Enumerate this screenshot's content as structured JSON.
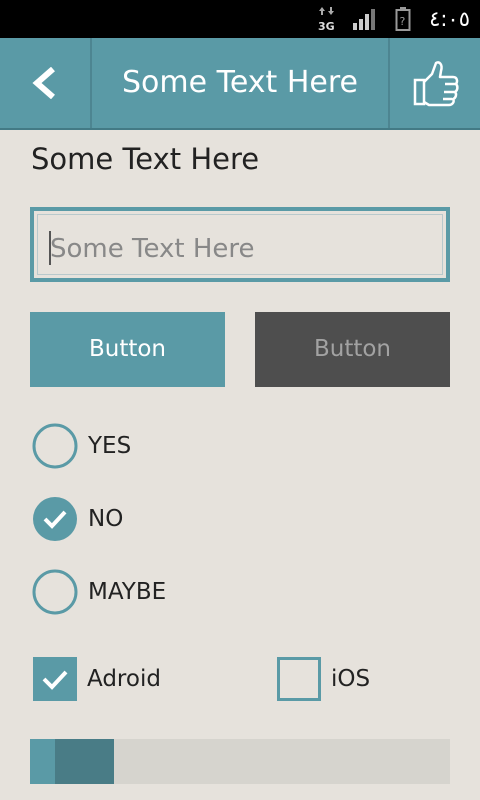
{
  "status_bar": {
    "network_type": "3G",
    "time": "٤:٠٥"
  },
  "app_bar": {
    "title": "Some Text Here"
  },
  "content": {
    "heading": "Some Text Here",
    "input": {
      "value": "",
      "placeholder": "Some Text Here"
    },
    "buttons": {
      "primary_label": "Button",
      "disabled_label": "Button"
    },
    "radios": [
      {
        "label": "YES",
        "checked": false
      },
      {
        "label": "NO",
        "checked": true
      },
      {
        "label": "MAYBE",
        "checked": false
      }
    ],
    "checkboxes": [
      {
        "label": "Adroid",
        "checked": true
      },
      {
        "label": "iOS",
        "checked": false
      }
    ],
    "progress": {
      "secondary_fraction": 0.2,
      "primary_start_fraction": 0.06,
      "primary_fraction": 0.14
    }
  },
  "colors": {
    "accent": "#5a9aa6",
    "accent_dark": "#497c86",
    "background": "#e6e2dc",
    "disabled_button": "#4e4e4e",
    "status_bar": "#000000"
  },
  "icons": {
    "back": "arrow-left-icon",
    "like": "thumbs-up-icon",
    "network": "network-3g-icon",
    "signal": "signal-icon",
    "battery": "battery-unknown-icon",
    "check": "check-icon"
  }
}
